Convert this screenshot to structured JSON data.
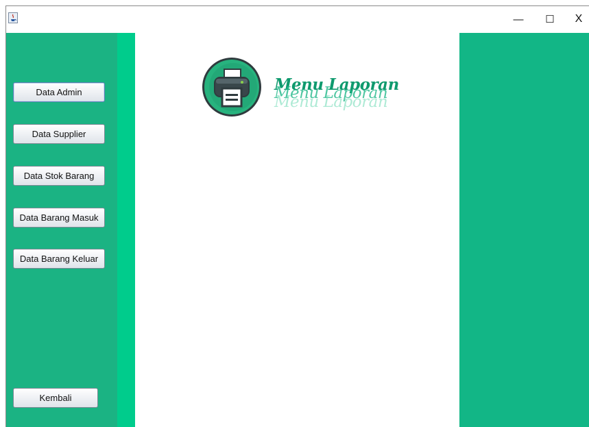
{
  "window": {
    "controls": {
      "minimize": "—",
      "maximize": "☐",
      "close": "X"
    }
  },
  "sidebar": {
    "buttons": [
      {
        "label": "Data Admin"
      },
      {
        "label": "Data Supplier"
      },
      {
        "label": "Data Stok Barang"
      },
      {
        "label": "Data Barang Masuk"
      },
      {
        "label": "Data Barang Keluar"
      }
    ],
    "back_button": {
      "label": "Kembali"
    }
  },
  "main": {
    "title": "Menu Laporan",
    "icon": "printer-icon"
  },
  "colors": {
    "sidebar": "#1bb383",
    "strip": "#00cc8c",
    "right_panel": "#12b686",
    "title_text": "#0f9a6e"
  }
}
